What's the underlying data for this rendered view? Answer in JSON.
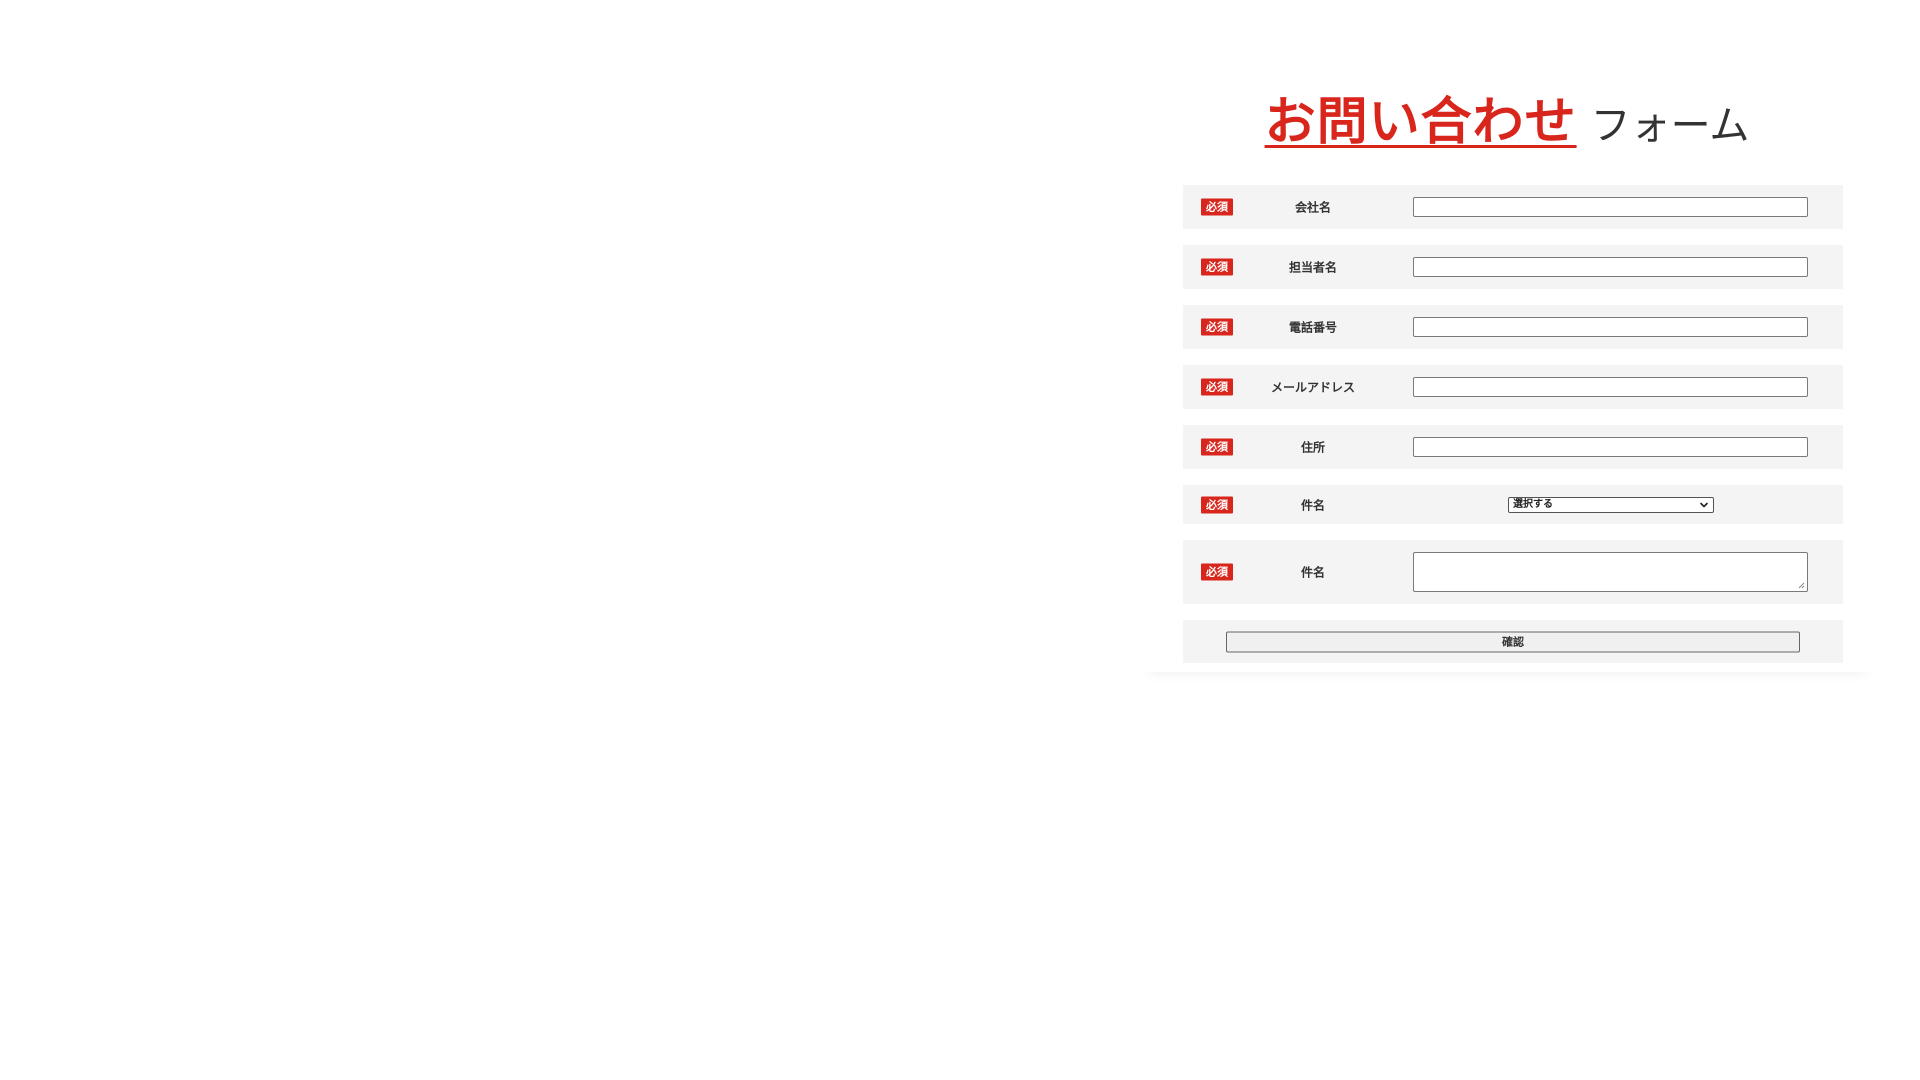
{
  "title": {
    "accent": "お問い合わせ",
    "rest": "フォーム"
  },
  "required_badge": "必須",
  "fields": [
    {
      "label": "会社名",
      "type": "text",
      "value": ""
    },
    {
      "label": "担当者名",
      "type": "text",
      "value": ""
    },
    {
      "label": "電話番号",
      "type": "text",
      "value": ""
    },
    {
      "label": "メールアドレス",
      "type": "text",
      "value": ""
    },
    {
      "label": "住所",
      "type": "text",
      "value": ""
    },
    {
      "label": "件名",
      "type": "select",
      "selected": "選択する"
    },
    {
      "label": "件名",
      "type": "textarea",
      "value": ""
    }
  ],
  "submit": {
    "label": "確認"
  },
  "colors": {
    "accent": "#d8261c",
    "row_background": "#f4f4f4",
    "text": "#333333"
  }
}
